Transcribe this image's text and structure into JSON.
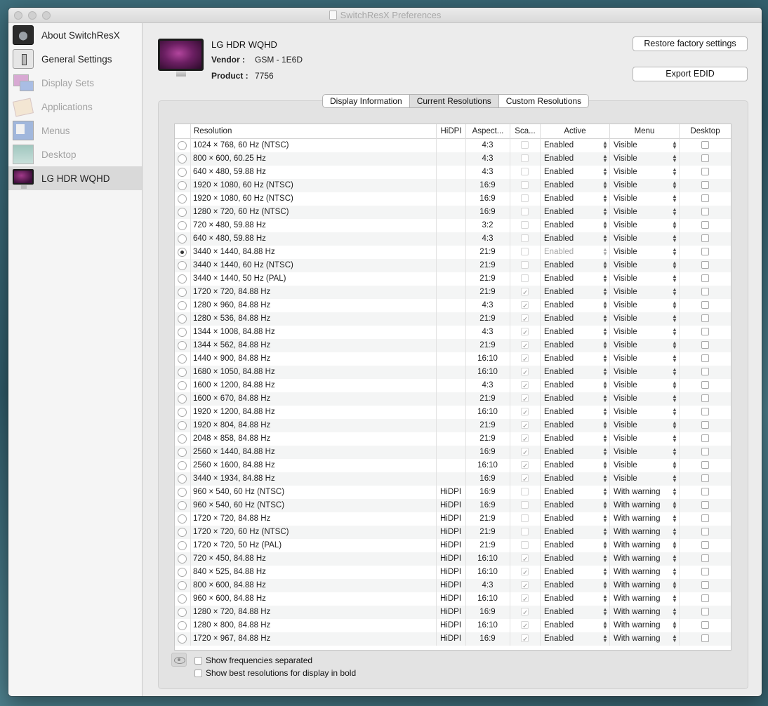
{
  "window": {
    "title": "SwitchResX Preferences"
  },
  "sidebar": {
    "items": [
      {
        "label": "About SwitchResX",
        "icon": "switchresx-gear-icon",
        "enabled": true
      },
      {
        "label": "General Settings",
        "icon": "general-settings-switch-icon",
        "enabled": true
      },
      {
        "label": "Display Sets",
        "icon": "display-sets-icon",
        "enabled": false
      },
      {
        "label": "Applications",
        "icon": "applications-icon",
        "enabled": false
      },
      {
        "label": "Menus",
        "icon": "menus-icon",
        "enabled": false
      },
      {
        "label": "Desktop",
        "icon": "desktop-icon",
        "enabled": false
      },
      {
        "label": "LG HDR WQHD",
        "icon": "monitor-icon",
        "enabled": true,
        "selected": true
      }
    ]
  },
  "display": {
    "name": "LG HDR WQHD",
    "vendor_label": "Vendor :",
    "vendor": "GSM - 1E6D",
    "product_label": "Product :",
    "product": "7756"
  },
  "buttons": {
    "restore": "Restore factory settings",
    "export": "Export EDID"
  },
  "tabs": [
    {
      "label": "Display Information",
      "active": false
    },
    {
      "label": "Current Resolutions",
      "active": true
    },
    {
      "label": "Custom Resolutions",
      "active": false
    }
  ],
  "table": {
    "columns": [
      "Resolution",
      "HiDPI",
      "Aspect...",
      "Sca...",
      "Active",
      "Menu",
      "Desktop"
    ],
    "rows": [
      {
        "res": "1024 × 768, 60 Hz (NTSC)",
        "hidpi": "",
        "aspect": "4:3",
        "scaled": false,
        "active": "Enabled",
        "menu": "Visible",
        "desktop": false,
        "selected": false
      },
      {
        "res": " 800 × 600, 60.25 Hz",
        "hidpi": "",
        "aspect": "4:3",
        "scaled": false,
        "active": "Enabled",
        "menu": "Visible",
        "desktop": false,
        "selected": false
      },
      {
        "res": " 640 × 480, 59.88 Hz",
        "hidpi": "",
        "aspect": "4:3",
        "scaled": false,
        "active": "Enabled",
        "menu": "Visible",
        "desktop": false,
        "selected": false
      },
      {
        "res": "1920 × 1080, 60 Hz (NTSC)",
        "hidpi": "",
        "aspect": "16:9",
        "scaled": false,
        "active": "Enabled",
        "menu": "Visible",
        "desktop": false,
        "selected": false
      },
      {
        "res": "1920 × 1080, 60 Hz (NTSC)",
        "hidpi": "",
        "aspect": "16:9",
        "scaled": false,
        "active": "Enabled",
        "menu": "Visible",
        "desktop": false,
        "selected": false
      },
      {
        "res": "1280 × 720, 60 Hz (NTSC)",
        "hidpi": "",
        "aspect": "16:9",
        "scaled": false,
        "active": "Enabled",
        "menu": "Visible",
        "desktop": false,
        "selected": false
      },
      {
        "res": " 720 × 480, 59.88 Hz",
        "hidpi": "",
        "aspect": "3:2",
        "scaled": false,
        "active": "Enabled",
        "menu": "Visible",
        "desktop": false,
        "selected": false
      },
      {
        "res": " 640 × 480, 59.88 Hz",
        "hidpi": "",
        "aspect": "4:3",
        "scaled": false,
        "active": "Enabled",
        "menu": "Visible",
        "desktop": false,
        "selected": false
      },
      {
        "res": "3440 × 1440, 84.88 Hz",
        "hidpi": "",
        "aspect": "21:9",
        "scaled": false,
        "active": "Enabled",
        "menu": "Visible",
        "desktop": false,
        "selected": true
      },
      {
        "res": "3440 × 1440, 60 Hz (NTSC)",
        "hidpi": "",
        "aspect": "21:9",
        "scaled": false,
        "active": "Enabled",
        "menu": "Visible",
        "desktop": false,
        "selected": false
      },
      {
        "res": "3440 × 1440, 50 Hz (PAL)",
        "hidpi": "",
        "aspect": "21:9",
        "scaled": false,
        "active": "Enabled",
        "menu": "Visible",
        "desktop": false,
        "selected": false
      },
      {
        "res": "1720 × 720, 84.88 Hz",
        "hidpi": "",
        "aspect": "21:9",
        "scaled": true,
        "active": "Enabled",
        "menu": "Visible",
        "desktop": false,
        "selected": false
      },
      {
        "res": "1280 × 960, 84.88 Hz",
        "hidpi": "",
        "aspect": "4:3",
        "scaled": true,
        "active": "Enabled",
        "menu": "Visible",
        "desktop": false,
        "selected": false
      },
      {
        "res": "1280 × 536, 84.88 Hz",
        "hidpi": "",
        "aspect": "21:9",
        "scaled": true,
        "active": "Enabled",
        "menu": "Visible",
        "desktop": false,
        "selected": false
      },
      {
        "res": "1344 × 1008, 84.88 Hz",
        "hidpi": "",
        "aspect": "4:3",
        "scaled": true,
        "active": "Enabled",
        "menu": "Visible",
        "desktop": false,
        "selected": false
      },
      {
        "res": "1344 × 562, 84.88 Hz",
        "hidpi": "",
        "aspect": "21:9",
        "scaled": true,
        "active": "Enabled",
        "menu": "Visible",
        "desktop": false,
        "selected": false
      },
      {
        "res": "1440 × 900, 84.88 Hz",
        "hidpi": "",
        "aspect": "16:10",
        "scaled": true,
        "active": "Enabled",
        "menu": "Visible",
        "desktop": false,
        "selected": false
      },
      {
        "res": "1680 × 1050, 84.88 Hz",
        "hidpi": "",
        "aspect": "16:10",
        "scaled": true,
        "active": "Enabled",
        "menu": "Visible",
        "desktop": false,
        "selected": false
      },
      {
        "res": "1600 × 1200, 84.88 Hz",
        "hidpi": "",
        "aspect": "4:3",
        "scaled": true,
        "active": "Enabled",
        "menu": "Visible",
        "desktop": false,
        "selected": false
      },
      {
        "res": "1600 × 670, 84.88 Hz",
        "hidpi": "",
        "aspect": "21:9",
        "scaled": true,
        "active": "Enabled",
        "menu": "Visible",
        "desktop": false,
        "selected": false
      },
      {
        "res": "1920 × 1200, 84.88 Hz",
        "hidpi": "",
        "aspect": "16:10",
        "scaled": true,
        "active": "Enabled",
        "menu": "Visible",
        "desktop": false,
        "selected": false
      },
      {
        "res": "1920 × 804, 84.88 Hz",
        "hidpi": "",
        "aspect": "21:9",
        "scaled": true,
        "active": "Enabled",
        "menu": "Visible",
        "desktop": false,
        "selected": false
      },
      {
        "res": "2048 × 858, 84.88 Hz",
        "hidpi": "",
        "aspect": "21:9",
        "scaled": true,
        "active": "Enabled",
        "menu": "Visible",
        "desktop": false,
        "selected": false
      },
      {
        "res": "2560 × 1440, 84.88 Hz",
        "hidpi": "",
        "aspect": "16:9",
        "scaled": true,
        "active": "Enabled",
        "menu": "Visible",
        "desktop": false,
        "selected": false
      },
      {
        "res": "2560 × 1600, 84.88 Hz",
        "hidpi": "",
        "aspect": "16:10",
        "scaled": true,
        "active": "Enabled",
        "menu": "Visible",
        "desktop": false,
        "selected": false
      },
      {
        "res": "3440 × 1934, 84.88 Hz",
        "hidpi": "",
        "aspect": "16:9",
        "scaled": true,
        "active": "Enabled",
        "menu": "Visible",
        "desktop": false,
        "selected": false
      },
      {
        "res": " 960 × 540, 60 Hz (NTSC)",
        "hidpi": "HiDPI",
        "aspect": "16:9",
        "scaled": false,
        "active": "Enabled",
        "menu": "With warning",
        "desktop": false,
        "selected": false
      },
      {
        "res": " 960 × 540, 60 Hz (NTSC)",
        "hidpi": "HiDPI",
        "aspect": "16:9",
        "scaled": false,
        "active": "Enabled",
        "menu": "With warning",
        "desktop": false,
        "selected": false
      },
      {
        "res": "1720 × 720, 84.88 Hz",
        "hidpi": "HiDPI",
        "aspect": "21:9",
        "scaled": false,
        "active": "Enabled",
        "menu": "With warning",
        "desktop": false,
        "selected": false
      },
      {
        "res": "1720 × 720, 60 Hz (NTSC)",
        "hidpi": "HiDPI",
        "aspect": "21:9",
        "scaled": false,
        "active": "Enabled",
        "menu": "With warning",
        "desktop": false,
        "selected": false
      },
      {
        "res": "1720 × 720, 50 Hz (PAL)",
        "hidpi": "HiDPI",
        "aspect": "21:9",
        "scaled": false,
        "active": "Enabled",
        "menu": "With warning",
        "desktop": false,
        "selected": false
      },
      {
        "res": " 720 × 450, 84.88 Hz",
        "hidpi": "HiDPI",
        "aspect": "16:10",
        "scaled": true,
        "active": "Enabled",
        "menu": "With warning",
        "desktop": false,
        "selected": false
      },
      {
        "res": " 840 × 525, 84.88 Hz",
        "hidpi": "HiDPI",
        "aspect": "16:10",
        "scaled": true,
        "active": "Enabled",
        "menu": "With warning",
        "desktop": false,
        "selected": false
      },
      {
        "res": " 800 × 600, 84.88 Hz",
        "hidpi": "HiDPI",
        "aspect": "4:3",
        "scaled": true,
        "active": "Enabled",
        "menu": "With warning",
        "desktop": false,
        "selected": false
      },
      {
        "res": " 960 × 600, 84.88 Hz",
        "hidpi": "HiDPI",
        "aspect": "16:10",
        "scaled": true,
        "active": "Enabled",
        "menu": "With warning",
        "desktop": false,
        "selected": false
      },
      {
        "res": "1280 × 720, 84.88 Hz",
        "hidpi": "HiDPI",
        "aspect": "16:9",
        "scaled": true,
        "active": "Enabled",
        "menu": "With warning",
        "desktop": false,
        "selected": false
      },
      {
        "res": "1280 × 800, 84.88 Hz",
        "hidpi": "HiDPI",
        "aspect": "16:10",
        "scaled": true,
        "active": "Enabled",
        "menu": "With warning",
        "desktop": false,
        "selected": false
      },
      {
        "res": "1720 × 967, 84.88 Hz",
        "hidpi": "HiDPI",
        "aspect": "16:9",
        "scaled": true,
        "active": "Enabled",
        "menu": "With warning",
        "desktop": false,
        "selected": false
      }
    ]
  },
  "options": {
    "show_frequencies": {
      "label": "Show frequencies separated",
      "checked": false
    },
    "show_best_bold": {
      "label": "Show best resolutions for display in bold",
      "checked": false
    },
    "eye_icon": "eye-icon"
  }
}
